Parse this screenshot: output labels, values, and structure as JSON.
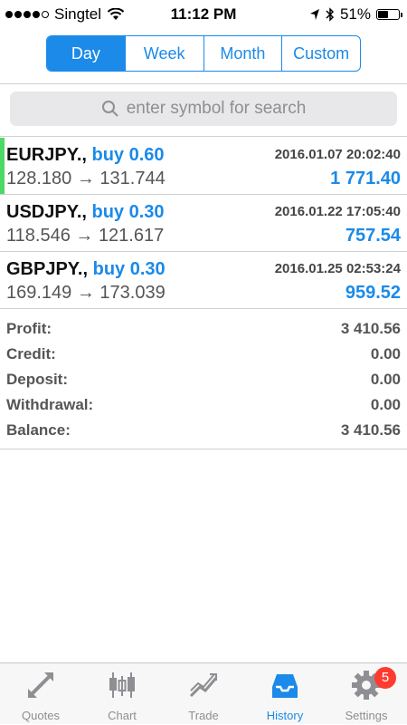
{
  "status_bar": {
    "carrier": "Singtel",
    "time": "11:12 PM",
    "battery": "51%",
    "battery_level": 0.51
  },
  "period_tabs": [
    "Day",
    "Week",
    "Month",
    "Custom"
  ],
  "active_period": "Day",
  "search": {
    "placeholder": "enter symbol for search"
  },
  "trades": [
    {
      "symbol": "EURJPY.,",
      "side": "buy 0.60",
      "datetime": "2016.01.07 20:02:40",
      "open": "128.180",
      "arrow": "→",
      "close": "131.744",
      "profit": "1 771.40"
    },
    {
      "symbol": "USDJPY.,",
      "side": "buy 0.30",
      "datetime": "2016.01.22 17:05:40",
      "open": "118.546",
      "arrow": "→",
      "close": "121.617",
      "profit": "757.54"
    },
    {
      "symbol": "GBPJPY.,",
      "side": "buy 0.30",
      "datetime": "2016.01.25 02:53:24",
      "open": "169.149",
      "arrow": "→",
      "close": "173.039",
      "profit": "959.52"
    }
  ],
  "summary": [
    {
      "label": "Profit:",
      "value": "3 410.56"
    },
    {
      "label": "Credit:",
      "value": "0.00"
    },
    {
      "label": "Deposit:",
      "value": "0.00"
    },
    {
      "label": "Withdrawal:",
      "value": "0.00"
    },
    {
      "label": "Balance:",
      "value": "3 410.56"
    }
  ],
  "tabbar": {
    "items": [
      {
        "label": "Quotes",
        "icon": "quotes-arrows-icon"
      },
      {
        "label": "Chart",
        "icon": "candlestick-chart-icon"
      },
      {
        "label": "Trade",
        "icon": "trade-chart-icon"
      },
      {
        "label": "History",
        "icon": "inbox-tray-icon"
      },
      {
        "label": "Settings",
        "icon": "gear-icon"
      }
    ],
    "active": "History",
    "settings_badge": "5"
  },
  "colors": {
    "accent": "#1b8ae8",
    "buy_indicator": "#4cd964",
    "badge": "#ff3b30"
  }
}
